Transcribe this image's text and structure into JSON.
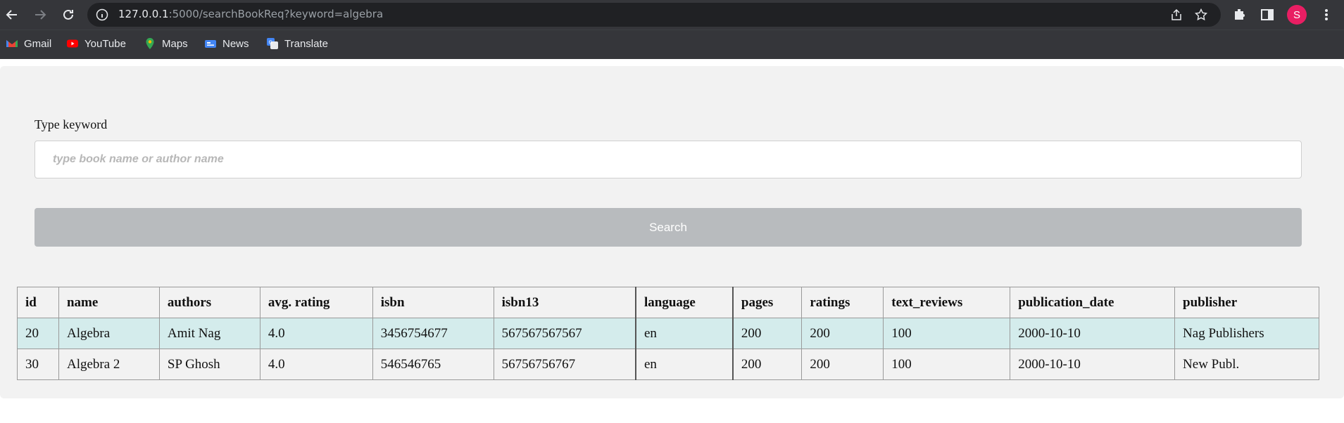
{
  "browser": {
    "url_host": "127.0.0.1",
    "url_rest": ":5000/searchBookReq?keyword=algebra",
    "avatar_letter": "S",
    "avatar_color": "#e91e63"
  },
  "bookmarks": [
    {
      "label": "Gmail",
      "icon": "gmail-icon"
    },
    {
      "label": "YouTube",
      "icon": "youtube-icon"
    },
    {
      "label": "Maps",
      "icon": "maps-icon"
    },
    {
      "label": "News",
      "icon": "news-icon"
    },
    {
      "label": "Translate",
      "icon": "translate-icon"
    }
  ],
  "search": {
    "label": "Type keyword",
    "placeholder": "type book name or author name",
    "button_label": "Search"
  },
  "table": {
    "headers": [
      "id",
      "name",
      "authors",
      "avg. rating",
      "isbn",
      "isbn13",
      "language",
      "pages",
      "ratings",
      "text_reviews",
      "publication_date",
      "publisher"
    ],
    "rows": [
      [
        "20",
        "Algebra",
        "Amit Nag",
        "4.0",
        "3456754677",
        "567567567567",
        "en",
        "200",
        "200",
        "100",
        "2000-10-10",
        "Nag Publishers"
      ],
      [
        "30",
        "Algebra 2",
        "SP Ghosh",
        "4.0",
        "546546765",
        "56756756767",
        "en",
        "200",
        "200",
        "100",
        "2000-10-10",
        "New Publ."
      ]
    ]
  },
  "colors": {
    "highlight_row": "#d4ecec",
    "button_bg": "#b8bbbe",
    "page_bg": "#f2f2f2"
  }
}
